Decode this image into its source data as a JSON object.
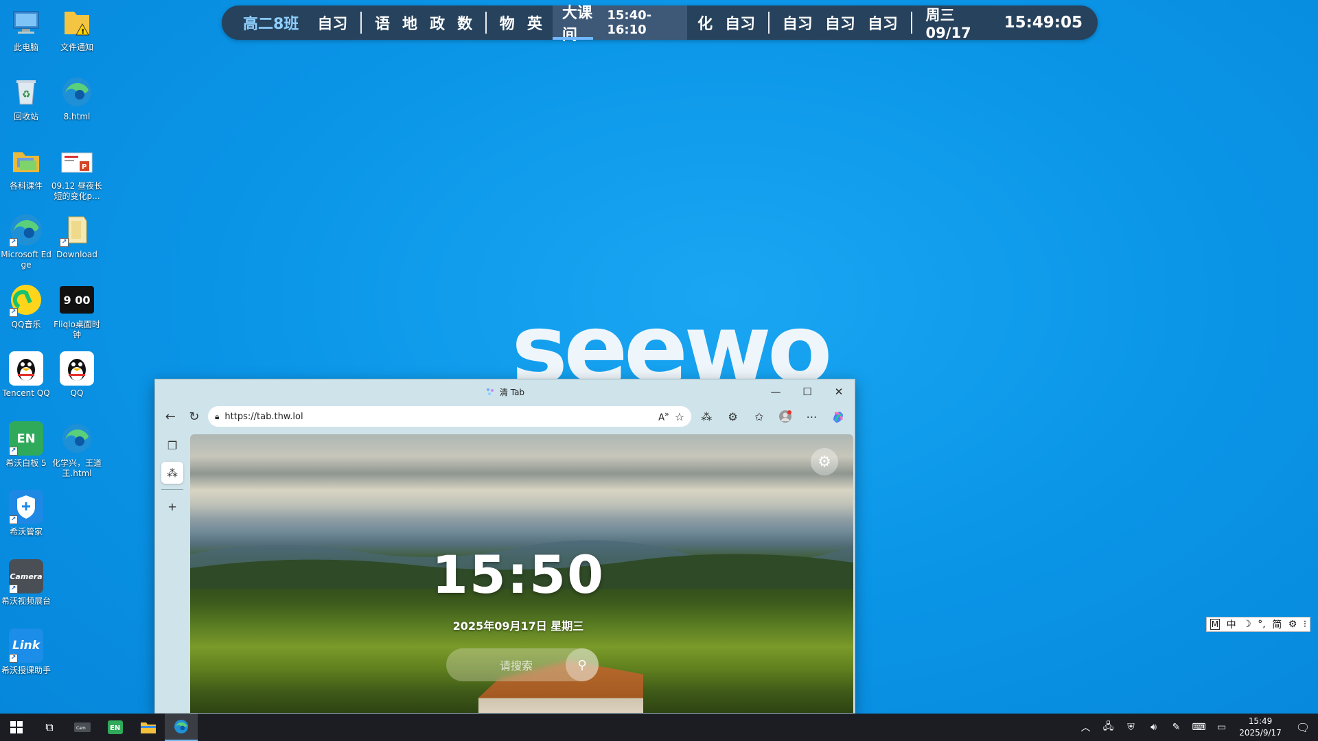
{
  "desktop": {
    "icons": [
      {
        "label": "此电脑",
        "icon": "computer-icon"
      },
      {
        "label": "文件通知",
        "icon": "folder-warning-icon"
      },
      {
        "label": "回收站",
        "icon": "recycle-bin-icon"
      },
      {
        "label": "8.html",
        "icon": "edge-icon"
      },
      {
        "label": "各科课件",
        "icon": "folder-icon"
      },
      {
        "label": "09.12 昼夜长短的变化p...",
        "icon": "powerpoint-icon"
      },
      {
        "label": "Microsoft Edge",
        "icon": "edge-icon"
      },
      {
        "label": "Download",
        "icon": "folder-icon"
      },
      {
        "label": "QQ音乐",
        "icon": "qq-music-icon"
      },
      {
        "label": "Fliqlo桌面时钟",
        "icon": "fliqlo-icon"
      },
      {
        "label": "Tencent QQ",
        "icon": "qq-icon"
      },
      {
        "label": "QQ",
        "icon": "qq-icon"
      },
      {
        "label": "希沃白板 5",
        "icon": "easinote-icon"
      },
      {
        "label": "化学兴，王道王.html",
        "icon": "edge-icon"
      },
      {
        "label": "希沃管家",
        "icon": "seewo-manager-icon"
      },
      {
        "label": "希沃视频展台",
        "icon": "camera-icon"
      },
      {
        "label": "希沃授课助手",
        "icon": "link-icon"
      }
    ],
    "fliqlo_text": "9 00",
    "easinote_text": "EN",
    "camera_text": "Camera",
    "link_text": "Link"
  },
  "schedule": {
    "class_name": "高二8班",
    "group1": [
      "自习"
    ],
    "group2": [
      "语",
      "地",
      "政",
      "数"
    ],
    "group3": [
      "物",
      "英"
    ],
    "current_label": "大课间",
    "current_time": "15:40-16:10",
    "current_progress": 0.3,
    "group4": [
      "化",
      "自习"
    ],
    "group5": [
      "自习",
      "自习",
      "自习"
    ],
    "date": "周三 09/17",
    "clock": "15:49:05"
  },
  "wallpaper": {
    "logo": "seewo"
  },
  "browser": {
    "tab_title": "清 Tab",
    "url": "https://tab.thw.lol",
    "minimize": "—",
    "maximize": "☐",
    "close": "✕",
    "newtab": {
      "clock": "15:50",
      "date": "2025年09月17日 星期三",
      "search_placeholder": "请搜索"
    }
  },
  "ime": {
    "items": [
      "M",
      "中",
      "☽",
      "°,",
      "简",
      "⚙",
      "⁝"
    ]
  },
  "taskbar": {
    "time": "15:49",
    "date": "2025/9/17",
    "colors": {
      "bg": "#1b1d22",
      "accent": "#76b9ed"
    }
  }
}
